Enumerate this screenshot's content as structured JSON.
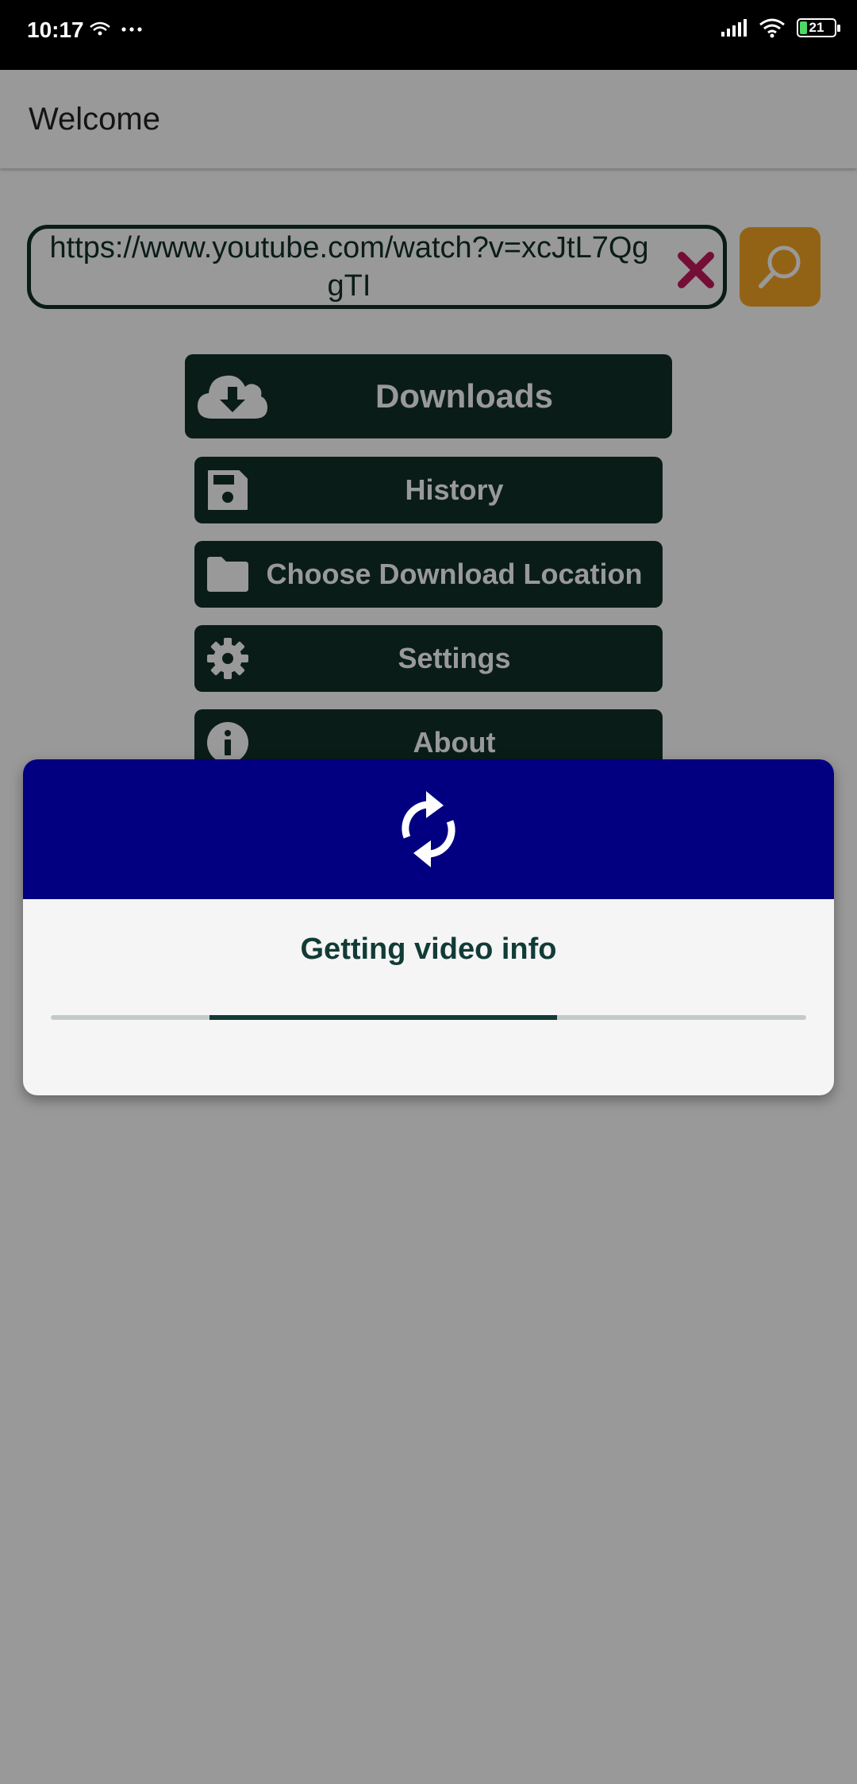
{
  "status_bar": {
    "time": "10:17",
    "left_icons": [
      "wifi-calling-icon",
      "more-dots-icon"
    ],
    "battery_level": "21"
  },
  "app_bar": {
    "title": "Welcome"
  },
  "url_input": {
    "value": "https://www.youtube.com/watch?v=xcJtL7QggTI"
  },
  "menu": {
    "downloads": "Downloads",
    "history": "History",
    "download_location": "Choose Download Location",
    "settings": "Settings",
    "about": "About"
  },
  "dialog": {
    "icon": "sync-icon",
    "message": "Getting video info",
    "progress": {
      "indeterminate": true,
      "segment_start": 0.21,
      "segment_end": 0.67
    }
  },
  "colors": {
    "primary": "#123029",
    "accent": "#f5a623",
    "clear": "#c2185b",
    "dialog_header": "#020080"
  }
}
